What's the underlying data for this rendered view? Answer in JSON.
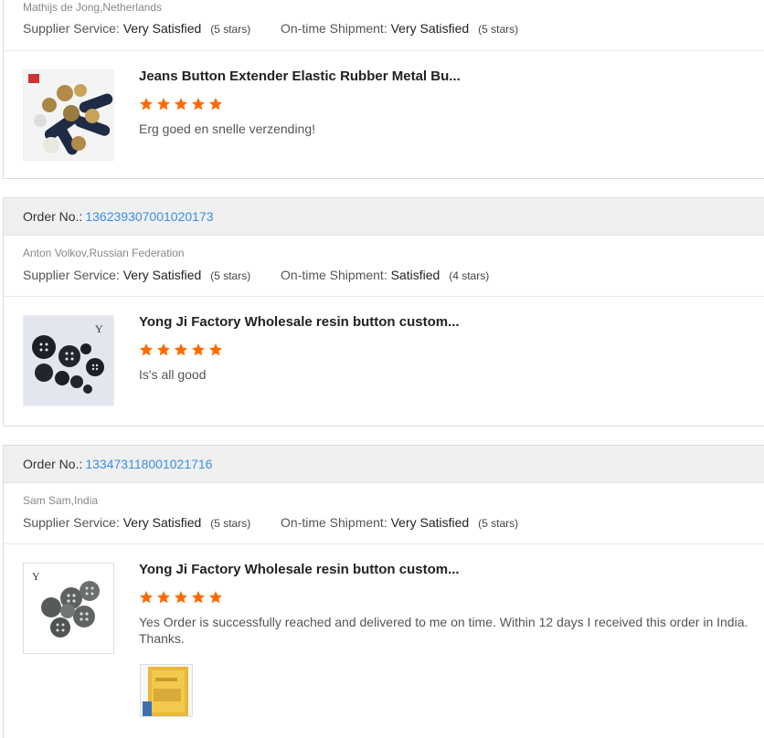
{
  "labels": {
    "order_no": "Order No.:",
    "supplier_service": "Supplier Service:",
    "ontime_shipment": "On-time Shipment:"
  },
  "colors": {
    "star": "#ff6a00",
    "order_link": "#3a8ee6"
  },
  "reviews": [
    {
      "buyer": "Mathijs de Jong,Netherlands",
      "supplier_value": "Very Satisfied",
      "supplier_stars": "(5 stars)",
      "shipment_value": "Very Satisfied",
      "shipment_stars": "(5 stars)",
      "product_title": "Jeans Button Extender Elastic Rubber Metal Bu...",
      "rating": 5,
      "comment": "Erg goed en snelle verzending!"
    },
    {
      "order_number": "136239307001020173",
      "buyer": "Anton Volkov,Russian Federation",
      "supplier_value": "Very Satisfied",
      "supplier_stars": "(5 stars)",
      "shipment_value": "Satisfied",
      "shipment_stars": "(4 stars)",
      "product_title": "Yong Ji Factory Wholesale resin button custom...",
      "rating": 5,
      "comment": "Is's all good"
    },
    {
      "order_number": "133473118001021716",
      "buyer": "Sam Sam,India",
      "supplier_value": "Very Satisfied",
      "supplier_stars": "(5 stars)",
      "shipment_value": "Very Satisfied",
      "shipment_stars": "(5 stars)",
      "product_title": "Yong Ji Factory Wholesale resin button custom...",
      "rating": 5,
      "comment": "Yes Order is successfully reached and delivered to me on time. Within 12 days I received this order in India. Thanks."
    }
  ]
}
